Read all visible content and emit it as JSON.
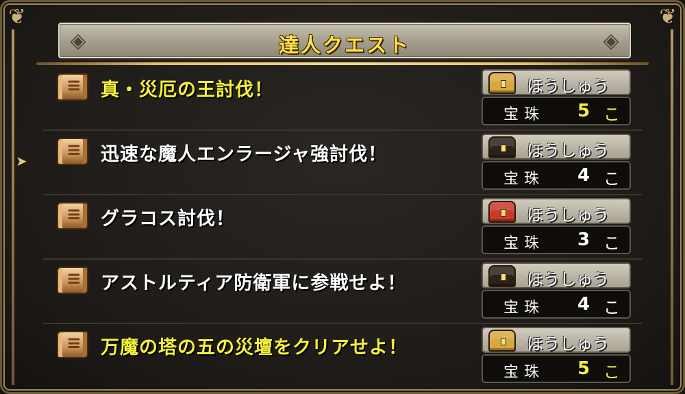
{
  "panel": {
    "title": "達人クエスト"
  },
  "colors": {
    "highlight_yellow": "#f5f03a",
    "normal_white": "#ffffff",
    "chest_gold": "#d9a640",
    "chest_black": "#2b231b",
    "chest_red": "#c8392a"
  },
  "quests": [
    {
      "title": "真・災厄の王討伐！",
      "highlight": true,
      "reward_label": "ほうしゅう",
      "reward_item": "宝珠",
      "reward_count": "5",
      "reward_unit": "こ",
      "chest": "chest-gold-icon"
    },
    {
      "title": "迅速な魔人エンラージャ強討伐！",
      "highlight": false,
      "reward_label": "ほうしゅう",
      "reward_item": "宝珠",
      "reward_count": "4",
      "reward_unit": "こ",
      "chest": "chest-black-icon"
    },
    {
      "title": "グラコス討伐！",
      "highlight": false,
      "reward_label": "ほうしゅう",
      "reward_item": "宝珠",
      "reward_count": "3",
      "reward_unit": "こ",
      "chest": "chest-red-icon"
    },
    {
      "title": "アストルティア防衛軍に参戦せよ！",
      "highlight": false,
      "reward_label": "ほうしゅう",
      "reward_item": "宝珠",
      "reward_count": "4",
      "reward_unit": "こ",
      "chest": "chest-black-icon"
    },
    {
      "title": "万魔の塔の五の災壇をクリアせよ！",
      "highlight": true,
      "reward_label": "ほうしゅう",
      "reward_item": "宝珠",
      "reward_count": "5",
      "reward_unit": "こ",
      "chest": "chest-gold-icon"
    }
  ],
  "selected_index": 1
}
